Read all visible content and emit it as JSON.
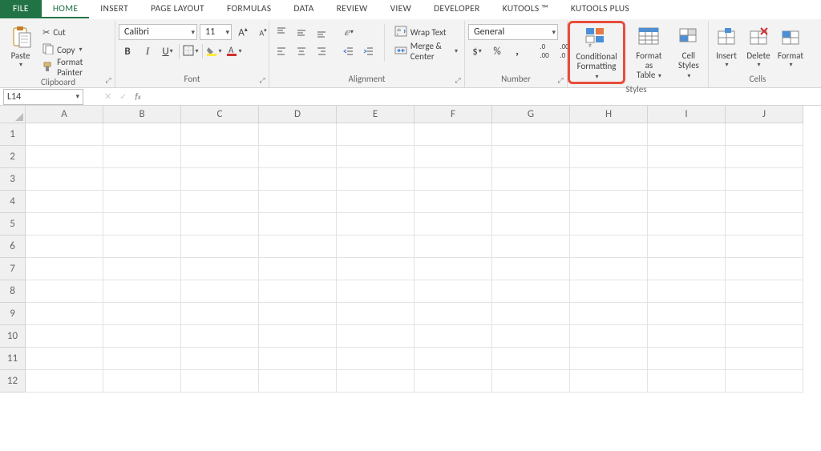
{
  "tabs": {
    "file": "FILE",
    "home": "HOME",
    "insert": "INSERT",
    "pagelayout": "PAGE LAYOUT",
    "formulas": "FORMULAS",
    "data": "DATA",
    "review": "REVIEW",
    "view": "VIEW",
    "developer": "DEVELOPER",
    "kutools": "KUTOOLS ™",
    "kutoolsplus": "KUTOOLS PLUS"
  },
  "clipboard": {
    "paste": "Paste",
    "cut": "Cut",
    "copy": "Copy",
    "painter": "Format Painter",
    "group": "Clipboard"
  },
  "font": {
    "name": "Calibri",
    "size": "11",
    "group": "Font"
  },
  "alignment": {
    "wrap": "Wrap Text",
    "merge": "Merge & Center",
    "group": "Alignment"
  },
  "number": {
    "format": "General",
    "group": "Number"
  },
  "styles": {
    "cond1": "Conditional",
    "cond2": "Formatting",
    "fat1": "Format as",
    "fat2": "Table",
    "cell1": "Cell",
    "cell2": "Styles",
    "group": "Styles"
  },
  "cells": {
    "insert": "Insert",
    "delete": "Delete",
    "format": "Format",
    "group": "Cells"
  },
  "namebox": "L14",
  "currency": "$",
  "percent": "%",
  "comma": ",",
  "cols": [
    "A",
    "B",
    "C",
    "D",
    "E",
    "F",
    "G",
    "H",
    "I",
    "J"
  ],
  "rows": [
    "1",
    "2",
    "3",
    "4",
    "5",
    "6",
    "7",
    "8",
    "9",
    "10",
    "11",
    "12"
  ]
}
